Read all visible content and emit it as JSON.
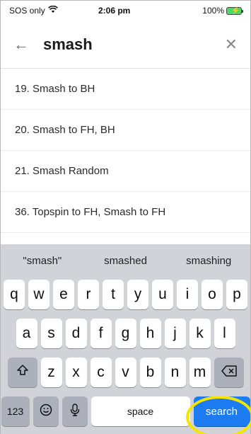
{
  "status_bar": {
    "carrier": "SOS only",
    "time": "2:06 pm",
    "battery": "100%",
    "wifi_icon": "wifi-icon",
    "battery_color": "#4cd964"
  },
  "search": {
    "query": "smash",
    "back_icon": "back-arrow-icon",
    "clear_icon": "close-icon"
  },
  "results": [
    "19. Smash to BH",
    "20. Smash to FH, BH",
    "21. Smash Random",
    "36. Topspin to FH, Smash to FH"
  ],
  "keyboard": {
    "suggestions": [
      "\"smash\"",
      "smashed",
      "smashing"
    ],
    "row1": [
      "q",
      "w",
      "e",
      "r",
      "t",
      "y",
      "u",
      "i",
      "o",
      "p"
    ],
    "row2": [
      "a",
      "s",
      "d",
      "f",
      "g",
      "h",
      "j",
      "k",
      "l"
    ],
    "row3": [
      "z",
      "x",
      "c",
      "v",
      "b",
      "n",
      "m"
    ],
    "numbers_label": "123",
    "space_label": "space",
    "search_label": "search",
    "search_key_color": "#1e7cf2",
    "highlight_color": "#f5e400"
  }
}
